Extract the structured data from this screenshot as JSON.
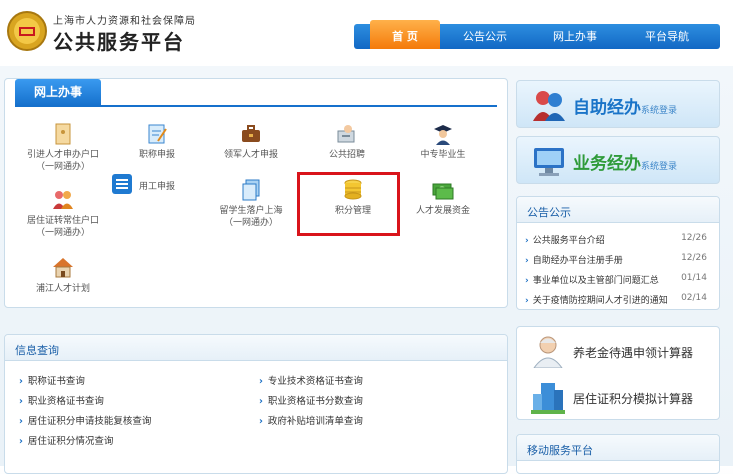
{
  "header": {
    "org_name": "上海市人力资源和社会保障局",
    "site_title": "公共服务平台",
    "logo_icon": "government-emblem-icon"
  },
  "nav": {
    "items": [
      {
        "label": "首 页",
        "active": true
      },
      {
        "label": "公告公示",
        "active": false
      },
      {
        "label": "网上办事",
        "active": false
      },
      {
        "label": "平台导航",
        "active": false
      }
    ]
  },
  "online_services": {
    "tab_label": "网上办事",
    "items": [
      {
        "label": "引进人才申办户口",
        "sub": "（一网通办）",
        "icon": "envelope-document-icon"
      },
      {
        "label": "职称申报",
        "sub": "",
        "icon": "certificate-edit-icon"
      },
      {
        "label": "领军人才申报",
        "sub": "",
        "icon": "briefcase-icon"
      },
      {
        "label": "公共招聘",
        "sub": "",
        "icon": "recruitment-icon"
      },
      {
        "label": "中专毕业生",
        "sub": "",
        "icon": "graduate-icon"
      },
      {
        "label": "居住证转常住户口",
        "sub": "（一网通办）",
        "icon": "family-icon"
      },
      {
        "label": "用工申报",
        "sub": "",
        "icon": "form-list-icon"
      },
      {
        "label": "留学生落户上海",
        "sub": "（一网通办）",
        "icon": "documents-icon"
      },
      {
        "label": "积分管理",
        "sub": "",
        "icon": "coin-stack-icon"
      },
      {
        "label": "人才发展资金",
        "sub": "",
        "icon": "money-icon"
      },
      {
        "label": "浦江人才计划",
        "sub": "",
        "icon": "house-icon"
      }
    ]
  },
  "info_query": {
    "title": "信息查询",
    "left": [
      "职称证书查询",
      "职业资格证书查询",
      "居住证积分申请技能复核查询",
      "居住证积分情况查询"
    ],
    "right": [
      "专业技术资格证书查询",
      "职业资格证书分数查询",
      "政府补贴培训清单查询"
    ]
  },
  "banners": {
    "self_service": {
      "title": "自助经办",
      "sub": "系统登录",
      "icon": "users-icon"
    },
    "business": {
      "title": "业务经办",
      "sub": "系统登录",
      "icon": "computer-icon"
    }
  },
  "announcements": {
    "title": "公告公示",
    "items": [
      {
        "text": "公共服务平台介绍",
        "date": "12/26"
      },
      {
        "text": "自助经办平台注册手册",
        "date": "12/26"
      },
      {
        "text": "事业单位以及主管部门问题汇总",
        "date": "01/14"
      },
      {
        "text": "关于疫情防控期间人才引进的通知",
        "date": "02/14"
      }
    ]
  },
  "calculators": {
    "items": [
      {
        "label": "养老金待遇申领计算器",
        "icon": "elderly-person-icon"
      },
      {
        "label": "居住证积分模拟计算器",
        "icon": "city-building-icon"
      }
    ]
  },
  "mobile": {
    "title": "移动服务平台"
  },
  "colors": {
    "brand_blue": "#1570cc",
    "nav_active": "#f47a0a",
    "highlight": "#d9141b"
  }
}
